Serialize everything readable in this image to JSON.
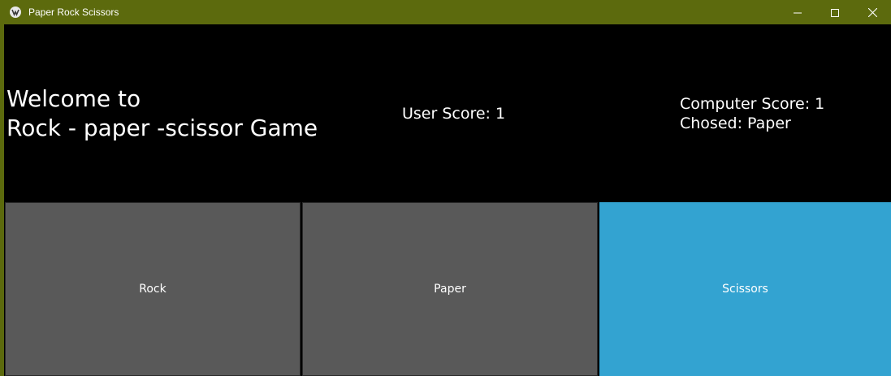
{
  "window": {
    "title": "Paper Rock Scissors",
    "icon": "kivy-logo-icon",
    "controls": [
      "minimize-icon",
      "maximize-icon",
      "close-icon"
    ]
  },
  "header": {
    "welcome_line1": "Welcome to",
    "welcome_line2": "Rock - paper -scissor Game",
    "user_score": "User Score: 1",
    "computer_score": "Computer Score: 1",
    "computer_choice": "Chosed: Paper"
  },
  "choices": {
    "rock": "Rock",
    "paper": "Paper",
    "scissors": "Scissors",
    "active": "scissors"
  },
  "colors": {
    "titlebar": "#5c6a0d",
    "button": "#595959",
    "button_active": "#33a3d1",
    "background": "#000000"
  }
}
